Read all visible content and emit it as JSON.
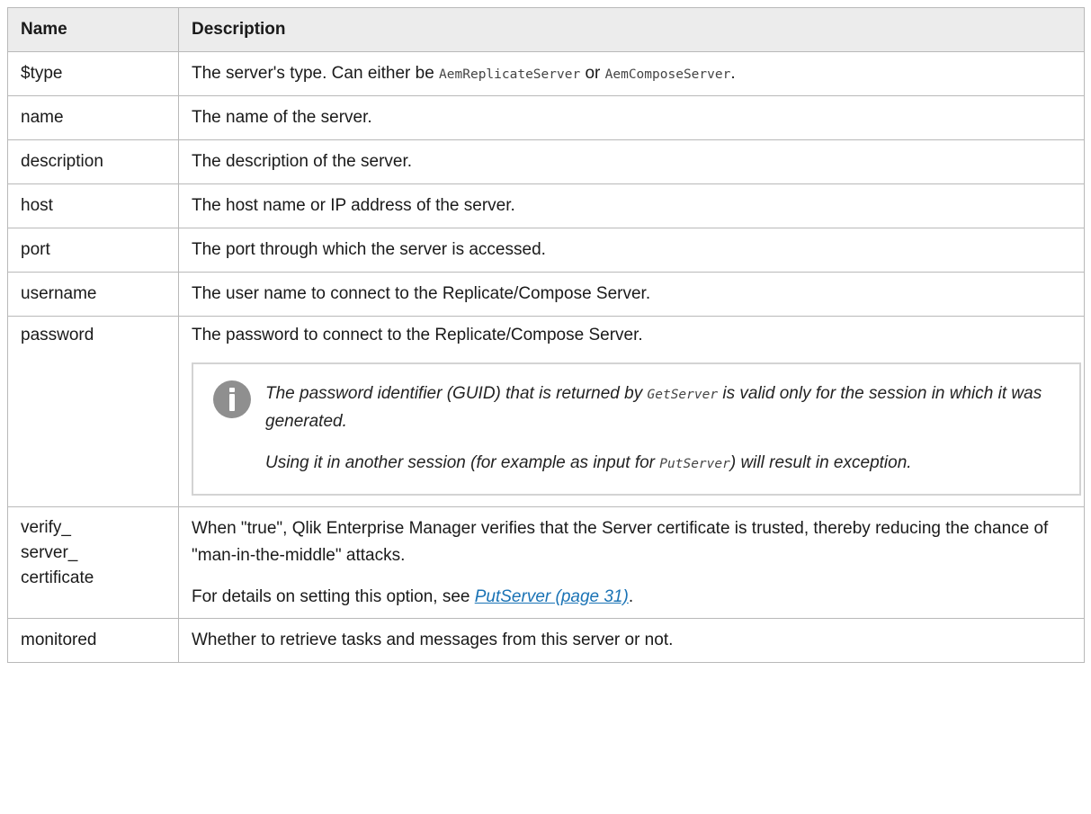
{
  "table": {
    "header": {
      "name": "Name",
      "description": "Description"
    },
    "rows": {
      "type": {
        "name": "$type",
        "desc_pre": "The server's type. Can either be ",
        "code1": "AemReplicateServer",
        "desc_mid": " or ",
        "code2": "AemComposeServer",
        "desc_post": "."
      },
      "name": {
        "name": "name",
        "desc": "The name of the server."
      },
      "description": {
        "name": "description",
        "desc": "The description of the server."
      },
      "host": {
        "name": "host",
        "desc": "The host name or IP address of the server."
      },
      "port": {
        "name": "port",
        "desc": "The port through which the server is accessed."
      },
      "username": {
        "name": "username",
        "desc": "The user name to connect to the Replicate/Compose Server."
      },
      "password": {
        "name": "password",
        "desc": "The password to connect to the Replicate/Compose Server.",
        "note": {
          "p1_pre": "The password identifier (GUID) that is returned by ",
          "p1_code": "GetServer",
          "p1_post": " is valid only for the session in which it was generated.",
          "p2_pre": "Using it in another session (for example as input for ",
          "p2_code": "PutServer",
          "p2_post": ") will result in exception."
        }
      },
      "verify": {
        "name_l1": "verify_",
        "name_l2": "server_",
        "name_l3": "certificate",
        "p1": "When \"true\", Qlik Enterprise Manager verifies that the Server certificate is trusted, thereby reducing the chance of \"man-in-the-middle\" attacks.",
        "p2_pre": "For details on setting this option, see ",
        "p2_link": "PutServer (page 31)",
        "p2_post": "."
      },
      "monitored": {
        "name": "monitored",
        "desc": "Whether to retrieve tasks and messages from this server or not."
      }
    }
  },
  "icons": {
    "note": "info-icon"
  },
  "colors": {
    "link": "#1a73b5",
    "header_bg": "#ececec",
    "border": "#b9b9b9",
    "icon_bg": "#8f8f8f"
  }
}
